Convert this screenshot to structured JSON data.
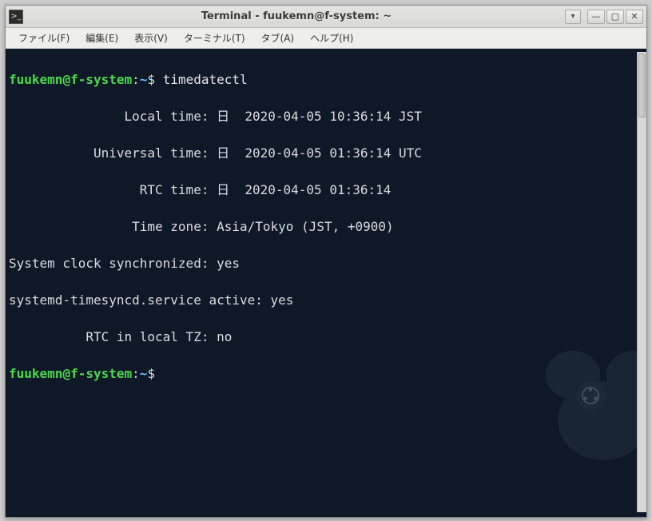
{
  "window": {
    "title": "Terminal - fuukemn@f-system: ~"
  },
  "menubar": {
    "file": "ファイル(F)",
    "edit": "編集(E)",
    "view": "表示(V)",
    "terminal": "ターミナル(T)",
    "tabs": "タブ(A)",
    "help": "ヘルプ(H)"
  },
  "prompt": {
    "user": "fuukemn",
    "at": "@",
    "host": "f-system",
    "colon": ":",
    "cwd": "~",
    "sigil": "$"
  },
  "cmd1": "timedatectl",
  "output": {
    "l1": "               Local time: 日  2020-04-05 10:36:14 JST",
    "l2": "           Universal time: 日  2020-04-05 01:36:14 UTC",
    "l3": "                 RTC time: 日  2020-04-05 01:36:14",
    "l4": "                Time zone: Asia/Tokyo (JST, +0900)",
    "l5": "System clock synchronized: yes",
    "l6": "systemd-timesyncd.service active: yes",
    "l7": "          RTC in local TZ: no"
  }
}
